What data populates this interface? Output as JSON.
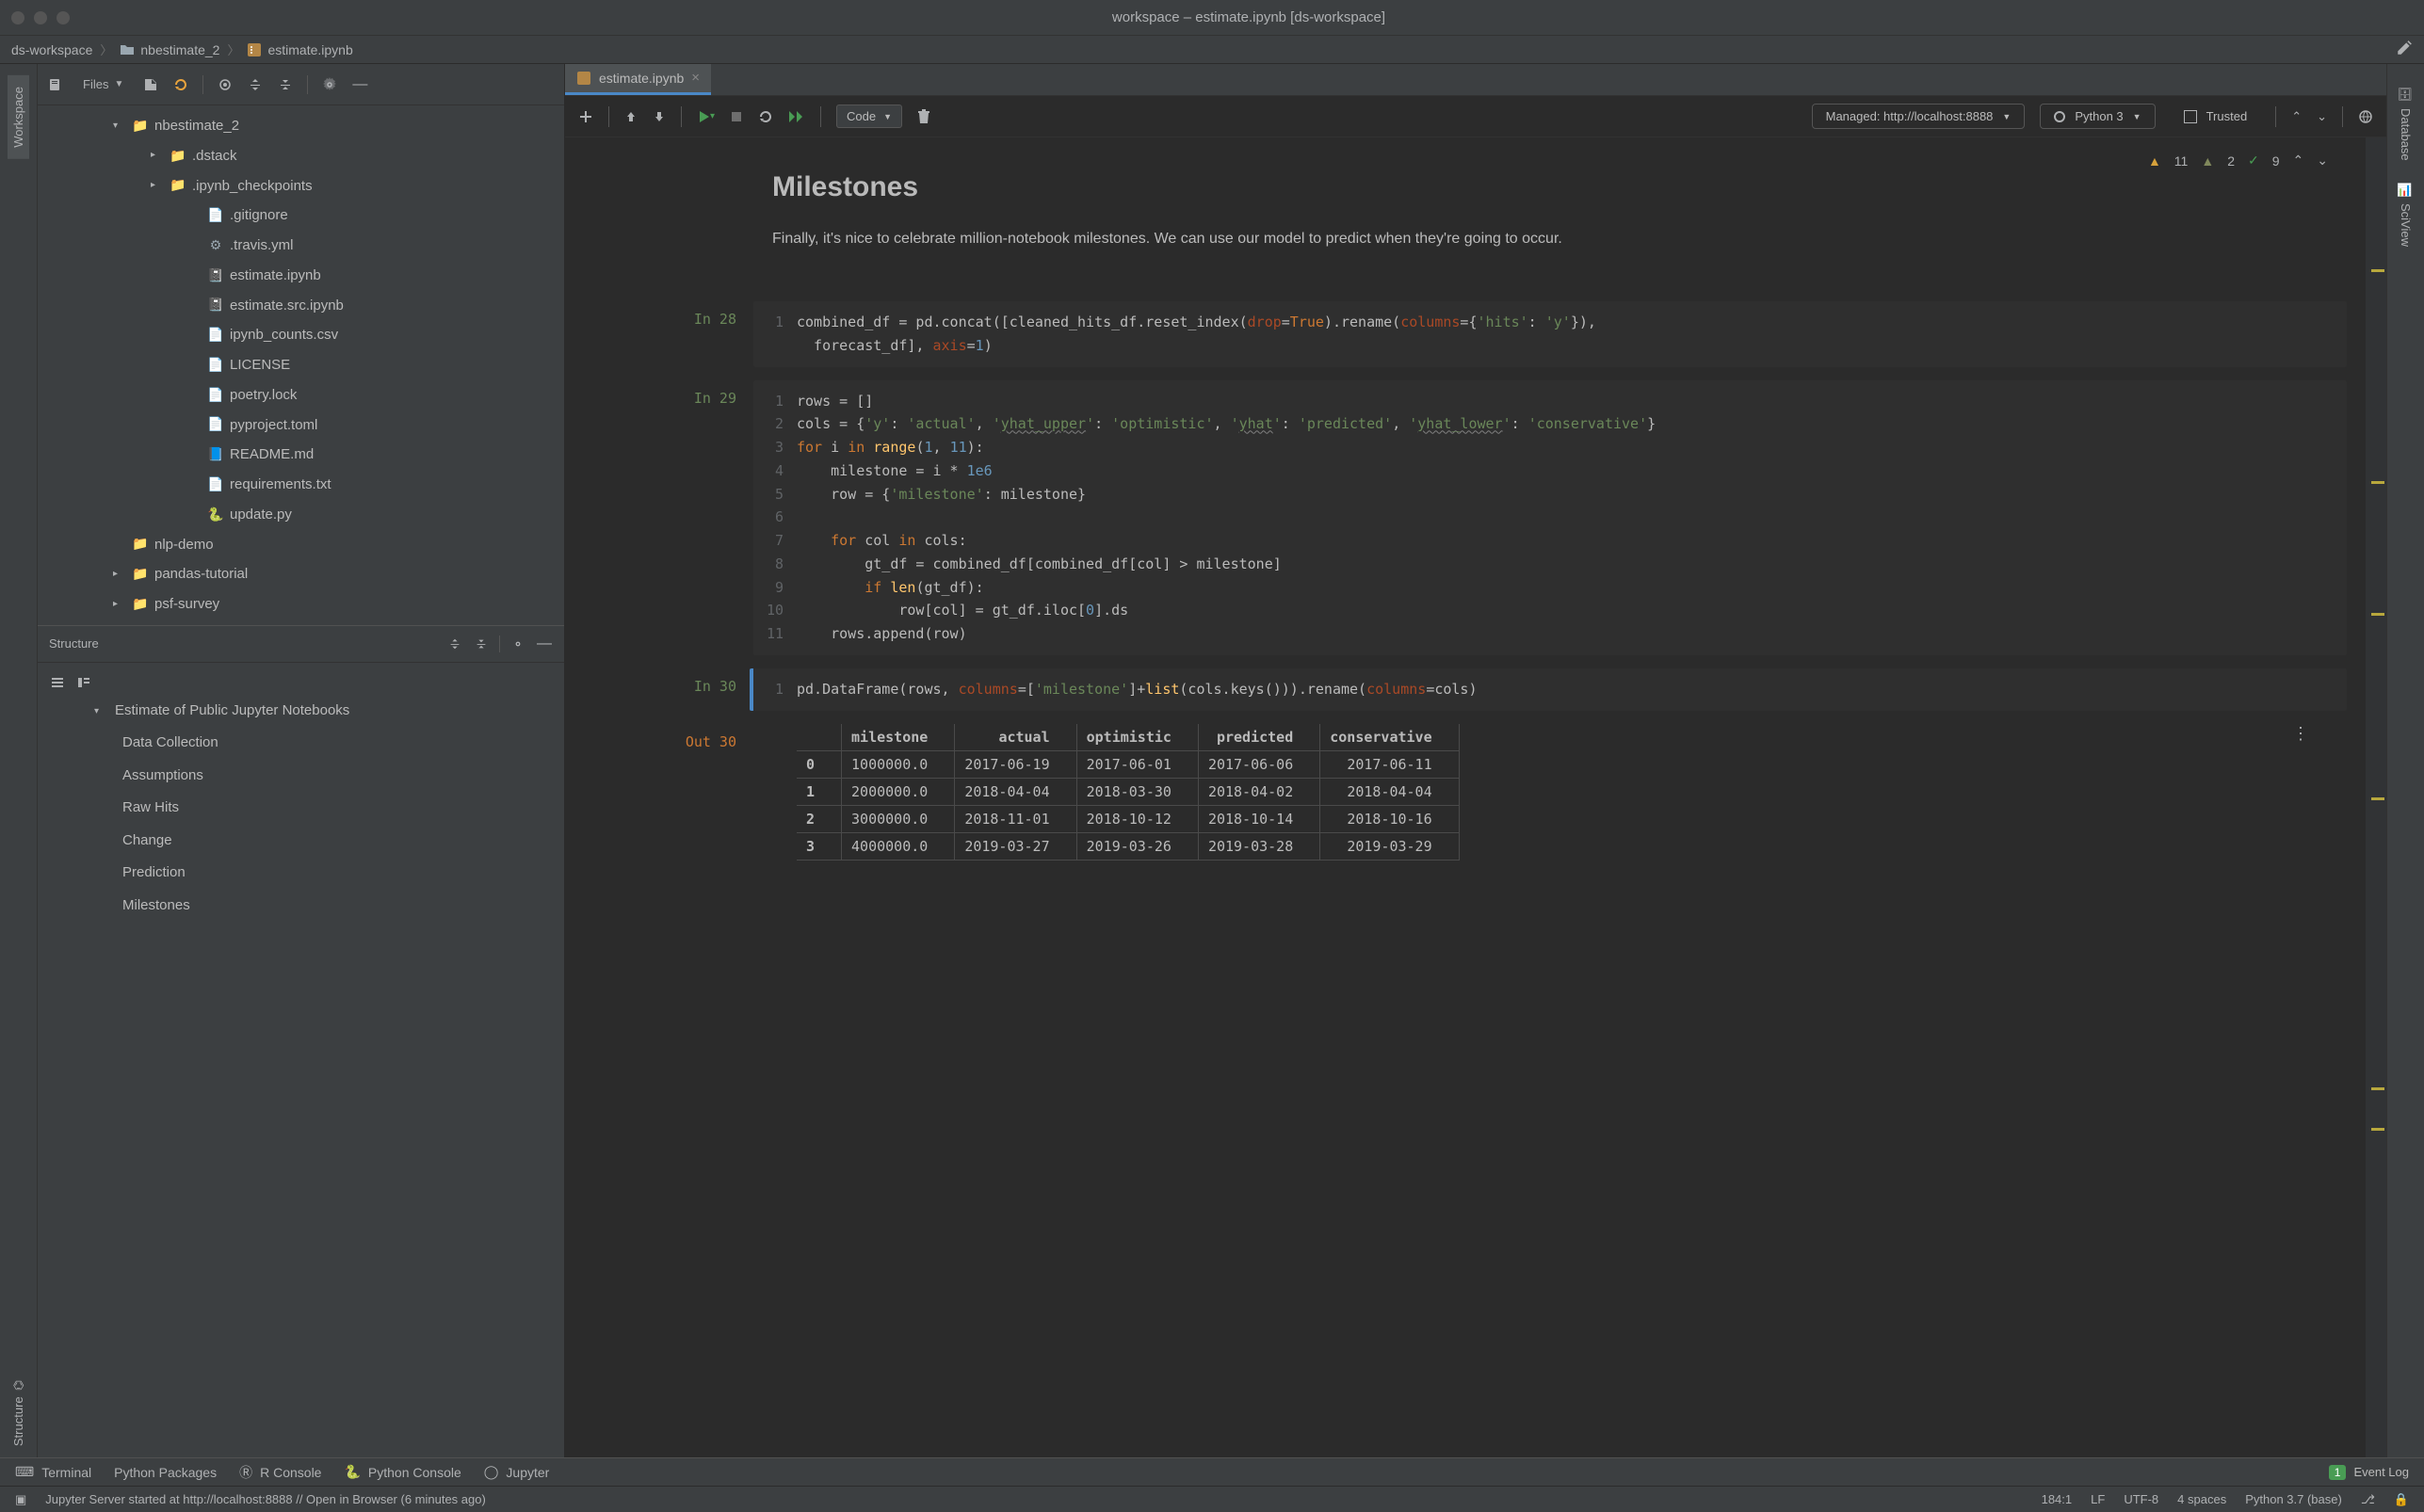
{
  "window": {
    "title": "workspace – estimate.ipynb [ds-workspace]"
  },
  "breadcrumbs": [
    "ds-workspace",
    "nbestimate_2",
    "estimate.ipynb"
  ],
  "project": {
    "panel_label": "Files",
    "root": "nbestimate_2",
    "folders_l1": [
      ".dstack",
      ".ipynb_checkpoints"
    ],
    "files_l1": [
      ".gitignore",
      ".travis.yml",
      "estimate.ipynb",
      "estimate.src.ipynb",
      "ipynb_counts.csv",
      "LICENSE",
      "poetry.lock",
      "pyproject.toml",
      "README.md",
      "requirements.txt",
      "update.py"
    ],
    "folders_sibling": [
      "nlp-demo",
      "pandas-tutorial",
      "psf-survey"
    ]
  },
  "structure": {
    "label": "Structure",
    "head": "Estimate of Public Jupyter Notebooks",
    "items": [
      "Data Collection",
      "Assumptions",
      "Raw Hits",
      "Change",
      "Prediction",
      "Milestones"
    ]
  },
  "left_gutter": {
    "workspace": "Workspace",
    "structure": "Structure"
  },
  "right_gutter": {
    "database": "Database",
    "sciview": "SciView"
  },
  "tab": {
    "name": "estimate.ipynb"
  },
  "nb_toolbar": {
    "cell_type": "Code",
    "managed": "Managed: http://localhost:8888",
    "kernel": "Python 3",
    "trusted": "Trusted"
  },
  "problems": {
    "warn1": "11",
    "warn2": "2",
    "ok": "9"
  },
  "markdown": {
    "title": "Milestones",
    "body": "Finally, it's nice to celebrate million-notebook milestones. We can use our model to predict when they're going to occur."
  },
  "cells": {
    "c28": {
      "label": "In 28"
    },
    "c29": {
      "label": "In 29"
    },
    "c30": {
      "label": "In 30"
    },
    "out30": {
      "label": "Out 30"
    }
  },
  "output_table": {
    "headers": [
      "",
      "milestone",
      "actual",
      "optimistic",
      "predicted",
      "conservative"
    ],
    "rows": [
      [
        "0",
        "1000000.0",
        "2017-06-19",
        "2017-06-01",
        "2017-06-06",
        "2017-06-11"
      ],
      [
        "1",
        "2000000.0",
        "2018-04-04",
        "2018-03-30",
        "2018-04-02",
        "2018-04-04"
      ],
      [
        "2",
        "3000000.0",
        "2018-11-01",
        "2018-10-12",
        "2018-10-14",
        "2018-10-16"
      ],
      [
        "3",
        "4000000.0",
        "2019-03-27",
        "2019-03-26",
        "2019-03-28",
        "2019-03-29"
      ]
    ]
  },
  "bottom_tabs": {
    "terminal": "Terminal",
    "py_pkg": "Python Packages",
    "r_console": "R Console",
    "py_console": "Python Console",
    "jupyter": "Jupyter",
    "event_log": "Event Log",
    "event_count": "1"
  },
  "status": {
    "msg": "Jupyter Server started at http://localhost:8888 // Open in Browser (6 minutes ago)",
    "pos": "184:1",
    "lf": "LF",
    "enc": "UTF-8",
    "indent": "4 spaces",
    "interp": "Python 3.7 (base)"
  }
}
